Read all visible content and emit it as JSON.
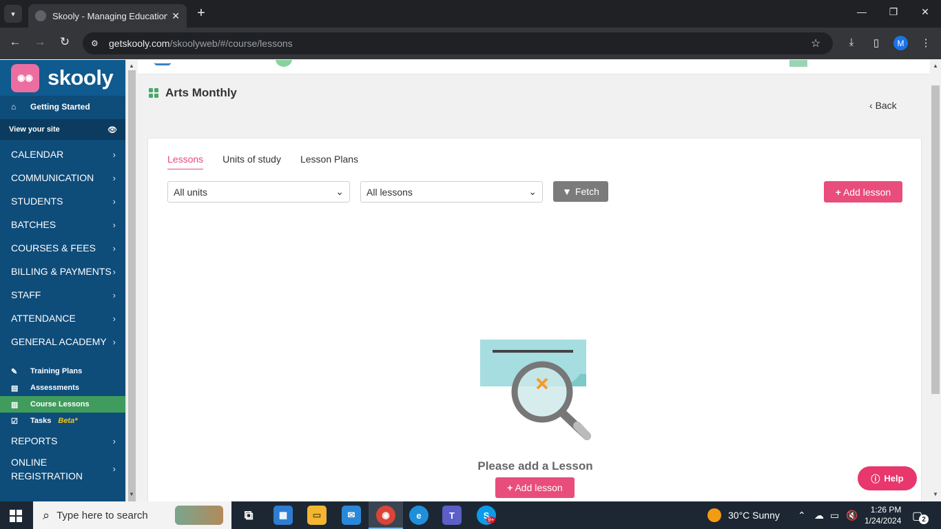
{
  "browser": {
    "tab_title": "Skooly - Managing Educational",
    "tab_close": "✕",
    "new_tab": "+",
    "url_host": "getskooly.com",
    "url_path": "/skoolyweb/#/course/lessons",
    "profile_initial": "M"
  },
  "sidebar": {
    "logo_text": "skooly",
    "getting_started": "Getting Started",
    "view_site": "View your site",
    "menu": [
      {
        "label": "CALENDAR"
      },
      {
        "label": "COMMUNICATION"
      },
      {
        "label": "STUDENTS"
      },
      {
        "label": "BATCHES"
      },
      {
        "label": "COURSES & FEES"
      },
      {
        "label": "BILLING & PAYMENTS"
      },
      {
        "label": "STAFF"
      },
      {
        "label": "ATTENDANCE"
      },
      {
        "label": "GENERAL ACADEMY"
      }
    ],
    "sub": [
      {
        "label": "Training Plans"
      },
      {
        "label": "Assessments"
      },
      {
        "label": "Course Lessons"
      },
      {
        "label": "Tasks",
        "badge": "Beta*"
      }
    ],
    "reports": "REPORTS",
    "online_registration_1": "ONLINE",
    "online_registration_2": "REGISTRATION"
  },
  "main": {
    "page_title": "Arts Monthly",
    "back_label": "Back",
    "tabs": [
      {
        "label": "Lessons",
        "active": true
      },
      {
        "label": "Units of study"
      },
      {
        "label": "Lesson Plans"
      }
    ],
    "unit_filter": "All units",
    "lesson_filter": "All lessons",
    "fetch_label": "Fetch",
    "add_lesson_label": "Add lesson",
    "empty_message": "Please add a Lesson",
    "help_label": "Help"
  },
  "taskbar": {
    "search_placeholder": "Type here to search",
    "weather": "30°C  Sunny",
    "time": "1:26 PM",
    "date": "1/24/2024",
    "notification_count": "2",
    "skype_badge": "9+"
  },
  "colors": {
    "sidebar_bg": "#0e4c7a",
    "active_item": "#3f9c5c",
    "accent_pink": "#e84d7c",
    "fetch_gray": "#7b7b7b"
  }
}
